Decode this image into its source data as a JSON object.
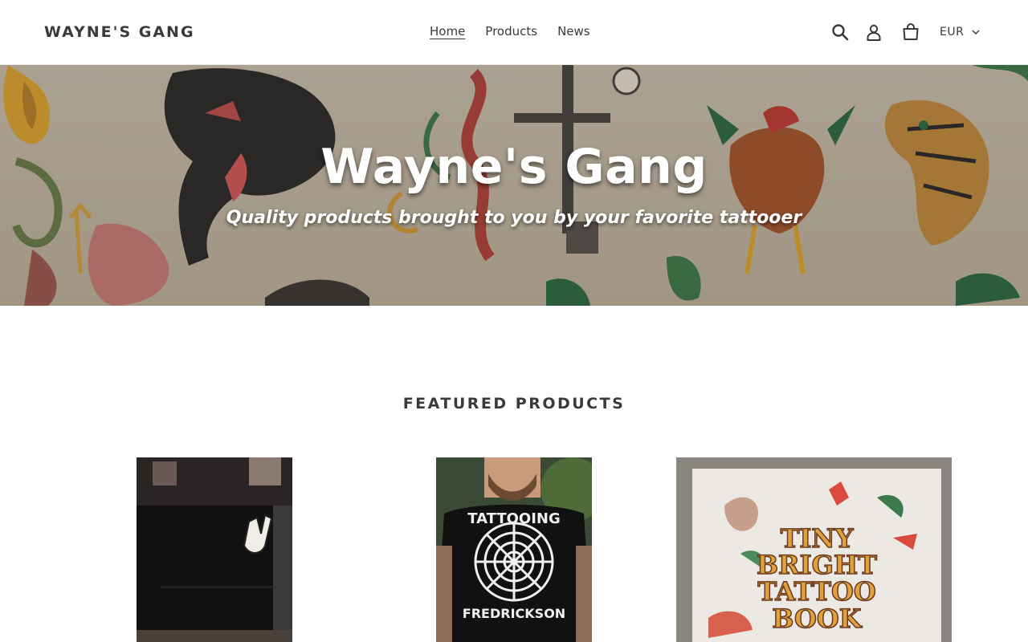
{
  "header": {
    "logo": "WAYNE'S GANG",
    "nav": [
      {
        "label": "Home",
        "active": true
      },
      {
        "label": "Products",
        "active": false
      },
      {
        "label": "News",
        "active": false
      }
    ],
    "icons": [
      "search-icon",
      "account-icon",
      "cart-icon"
    ],
    "currency": "EUR"
  },
  "hero": {
    "title": "Wayne's Gang",
    "subtitle": "Quality products brought to you by your favorite tattooer"
  },
  "featured": {
    "heading": "FEATURED PRODUCTS",
    "products": [
      {
        "image": "black-tote-bag-peace-hand"
      },
      {
        "image": "black-tshirt-tattooing-fredrickson"
      },
      {
        "image": "tiny-bright-tattoo-book"
      }
    ],
    "product3_text": [
      "TINY",
      "BRIGHT",
      "TATTOO",
      "BOOK"
    ],
    "product2_text": [
      "TATTOOING",
      "FREDRICKSON"
    ]
  },
  "colors": {
    "text": "#3a3a3a",
    "hero_base": "#c8bca9",
    "border": "#e8e8e8"
  }
}
